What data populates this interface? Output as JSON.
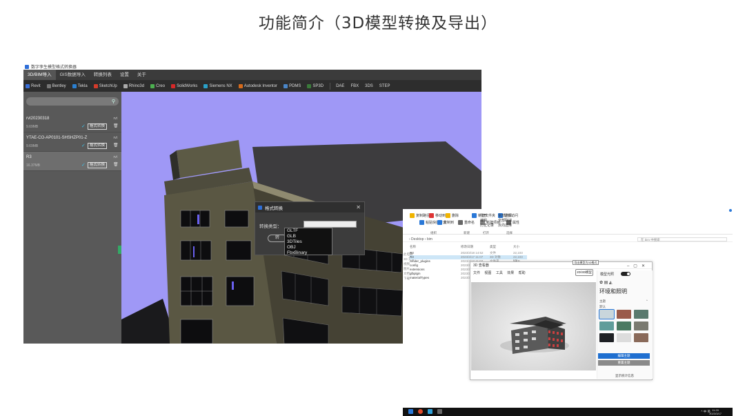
{
  "page_title": "功能简介（3D模型转换及导出）",
  "app": {
    "window_title": "数字孪生模型格式转换器",
    "menu": [
      "3D/BIM导入",
      "GIS数据导入",
      "转换列表",
      "设置",
      "关于"
    ],
    "toolbar": [
      "Revit",
      "Bentley",
      "Tekla",
      "SketchUp",
      "Rhino3d",
      "Creo",
      "SolidWorks",
      "Siemens NX",
      "Autodesk Inventor",
      "PDMS",
      "SP3D"
    ],
    "toolbar_formats": [
      "DAE",
      "FBX",
      "3DS",
      "STEP"
    ],
    "toolbar_colors": [
      "#3a6fd8",
      "#777",
      "#2b7fd0",
      "#d43b2b",
      "#aaa",
      "#4caf50",
      "#d62828",
      "#2aa0c8",
      "#d66a1b",
      "#4a86c8",
      "#3a7a3a"
    ],
    "search_icon": "search-icon",
    "models": [
      {
        "name": "rvt20230318",
        "ext": "rvt",
        "size": "9.69MB",
        "format_label": "格式转换"
      },
      {
        "name": "YTAE-CO-AP0101-SHSHZP01-Z",
        "ext": "rvt",
        "size": "9.69MB",
        "format_label": "格式转换"
      },
      {
        "name": "R3",
        "ext": "rvt",
        "size": "16.37MB",
        "format_label": "格式转换"
      }
    ],
    "dialog": {
      "title": "格式转换",
      "label": "转换类型：",
      "button": "转",
      "options": [
        "GLTF",
        "GLB",
        "3DTiles",
        "OBJ",
        "FbxBinary"
      ]
    }
  },
  "explorer": {
    "ribbon": [
      "复制路径",
      "粘贴快捷方式",
      "移动到",
      "复制到",
      "删除",
      "重命名",
      "新建文件夹",
      "新建项目",
      "轻松访问",
      "属性",
      "打开",
      "编辑",
      "历史记录",
      "全部选择",
      "全部取消",
      "反向选择"
    ],
    "ribbon_groups": [
      "组织",
      "新建",
      "打开",
      "选择"
    ],
    "path": "› Desktop › bim",
    "search_placeholder": "在 bim 中搜索",
    "columns": [
      "名称",
      "修改日期",
      "类型",
      "大小"
    ],
    "files": [
      {
        "name": "R3",
        "date": "2023/3/18 14:52",
        "type": "文件",
        "size": "22,103 KB",
        "selected": false
      },
      {
        "name": "R3",
        "date": "2023/3/17 11:07",
        "type": "3D 对象",
        "size": "22,103 KB",
        "selected": true
      },
      {
        "name": "render_plugins",
        "date": "2023/3/17 11:07",
        "type": "文件夹",
        "size": "1 KB",
        "selected": false
      },
      {
        "name": "config",
        "date": "2023/3/17 11:07",
        "type": "文件夹",
        "size": "",
        "selected": false
      },
      {
        "name": "extensions",
        "date": "2023/3/17 11:07",
        "type": "文件夹",
        "size": "",
        "selected": false
      },
      {
        "name": "glbplgin",
        "date": "2023/3/17 11:07",
        "type": "文件夹",
        "size": "",
        "selected": false
      },
      {
        "name": "materialTypes",
        "date": "2023/3/17 11:07",
        "type": "文件夹",
        "size": "",
        "selected": false
      }
    ],
    "nav": [
      "此电脑",
      "3D 对象",
      "视频",
      "图片",
      "文档",
      "下载"
    ]
  },
  "viewer": {
    "title": "3D 查看器",
    "menu": [
      "文件",
      "视图",
      "工具",
      "效果",
      "帮助"
    ],
    "tool_label": "2D/3D模型",
    "tooltip": "导出模型为3D格式",
    "lighting_label": "模型光照",
    "panel_title": "环境和照明",
    "theme_label": "主题",
    "theme_sub": "默认",
    "swatches": [
      "#c9d6dc",
      "#9a5a4a",
      "#5a7a6e",
      "#5f9d9a",
      "#4b7a62",
      "#7a7a70",
      "#1e2024",
      "#dcdcdc",
      "#8a6a5a"
    ],
    "primary_button": "编辑主题",
    "secondary_button": "重置主题",
    "status": "显示统计信息"
  },
  "taskbar": {
    "clock_time": "11:20",
    "clock_date": "2023/3/17",
    "tray": "^ 中 英",
    "icons": [
      "#2a78d7",
      "#e04a2a",
      "#2fa0d8",
      "#666"
    ]
  }
}
